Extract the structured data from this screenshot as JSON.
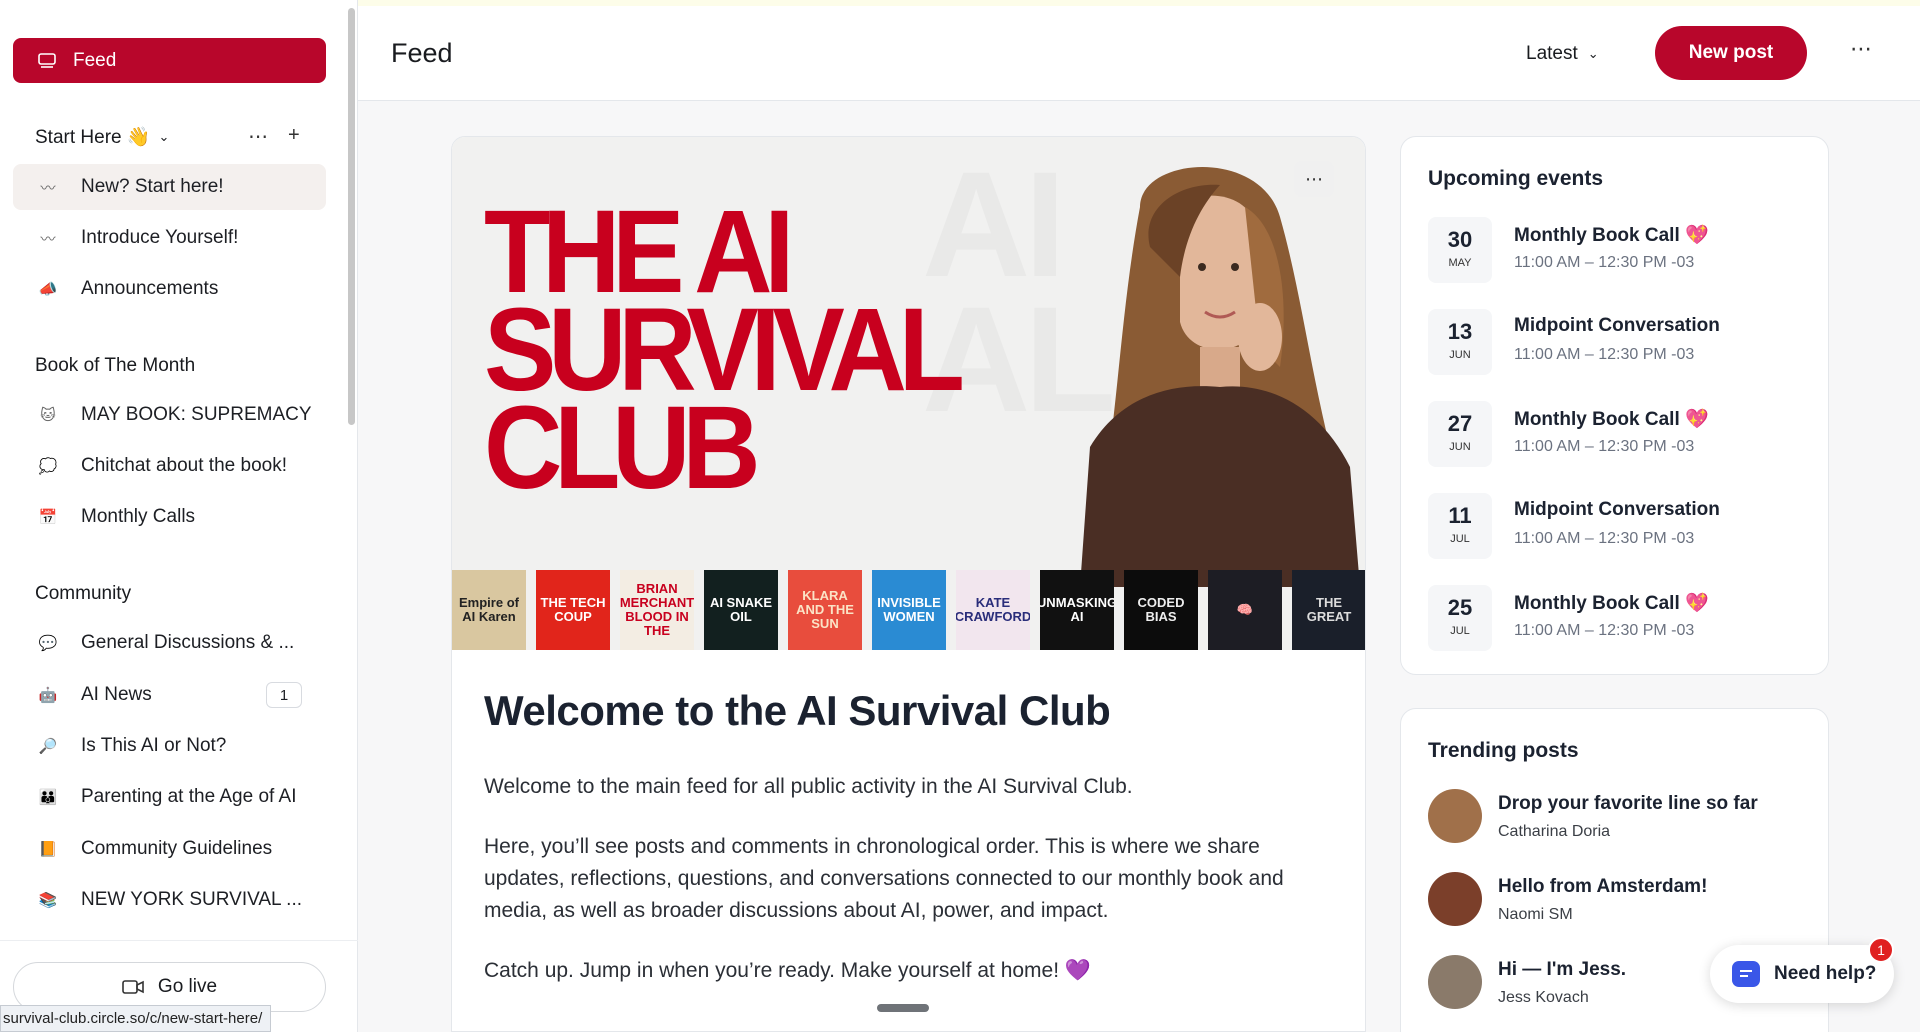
{
  "sidebar": {
    "feed_label": "Feed",
    "groups": {
      "start_here": "Start Here 👋",
      "book_of_month": "Book of The Month",
      "community": "Community"
    },
    "items": [
      {
        "icon": "〰",
        "label": "New? Start here!"
      },
      {
        "icon": "〰",
        "label": "Introduce Yourself!"
      },
      {
        "icon": "📣",
        "label": "Announcements"
      },
      {
        "icon": "🐱",
        "label": "MAY BOOK: SUPREMACY"
      },
      {
        "icon": "💭",
        "label": "Chitchat about the book!"
      },
      {
        "icon": "📅",
        "label": "Monthly Calls"
      },
      {
        "icon": "💬",
        "label": "General Discussions & ..."
      },
      {
        "icon": "🤖",
        "label": "AI News",
        "badge": "1"
      },
      {
        "icon": "🔎",
        "label": "Is This AI or Not?"
      },
      {
        "icon": "👪",
        "label": "Parenting at the Age of AI"
      },
      {
        "icon": "📙",
        "label": "Community Guidelines"
      },
      {
        "icon": "📚",
        "label": "NEW YORK SURVIVAL ..."
      }
    ],
    "go_live": "Go live",
    "status_url": "survival-club.circle.so/c/new-start-here/"
  },
  "header": {
    "title": "Feed",
    "sort": "Latest",
    "new_post": "New post"
  },
  "post": {
    "banner_title": [
      "THE AI",
      "SURVIVAL",
      "CLUB"
    ],
    "books": [
      {
        "title": "Empire of AI Karen",
        "bg": "#d9c7a0",
        "fg": "#222"
      },
      {
        "title": "THE TECH COUP",
        "bg": "#e1251b",
        "fg": "#fff"
      },
      {
        "title": "BRIAN MERCHANT BLOOD IN THE",
        "bg": "#f3ede3",
        "fg": "#c8001e"
      },
      {
        "title": "AI SNAKE OIL",
        "bg": "#12201f",
        "fg": "#fff"
      },
      {
        "title": "KLARA AND THE SUN",
        "bg": "#e84d3d",
        "fg": "#fbe3c6"
      },
      {
        "title": "INVISIBLE WOMEN",
        "bg": "#2a8bd3",
        "fg": "#fff"
      },
      {
        "title": "KATE CRAWFORD",
        "bg": "#f2e6ee",
        "fg": "#2a2d7a"
      },
      {
        "title": "UNMASKING AI",
        "bg": "#111",
        "fg": "#fff"
      },
      {
        "title": "CODED BIAS",
        "bg": "#0c0c0c",
        "fg": "#eee"
      },
      {
        "title": "🧠",
        "bg": "#1d1d24",
        "fg": "#e44d8a"
      },
      {
        "title": "THE GREAT",
        "bg": "#1a1f2a",
        "fg": "#ddd"
      }
    ],
    "title": "Welcome to the AI Survival Club",
    "paragraphs": [
      "Welcome to the main feed for all public activity in the AI Survival Club.",
      "Here, you’ll see posts and comments in chronological order. This is where we share updates, reflections, questions, and conversations connected to our monthly book and media, as well as broader discussions about AI, power, and impact.",
      "Catch up. Jump in when you’re ready. Make yourself at home! 💜"
    ]
  },
  "events": {
    "title": "Upcoming events",
    "items": [
      {
        "day": "30",
        "month": "MAY",
        "name": "Monthly Book Call 💖",
        "time": "11:00 AM – 12:30 PM -03"
      },
      {
        "day": "13",
        "month": "JUN",
        "name": "Midpoint Conversation",
        "time": "11:00 AM – 12:30 PM -03"
      },
      {
        "day": "27",
        "month": "JUN",
        "name": "Monthly Book Call 💖",
        "time": "11:00 AM – 12:30 PM -03"
      },
      {
        "day": "11",
        "month": "JUL",
        "name": "Midpoint Conversation",
        "time": "11:00 AM – 12:30 PM -03"
      },
      {
        "day": "25",
        "month": "JUL",
        "name": "Monthly Book Call 💖",
        "time": "11:00 AM – 12:30 PM -03"
      }
    ]
  },
  "trending": {
    "title": "Trending posts",
    "items": [
      {
        "title": "Drop your favorite line so far",
        "author": "Catharina Doria",
        "avatar_color": "#a0704a"
      },
      {
        "title": "Hello from Amsterdam!",
        "author": "Naomi SM",
        "avatar_color": "#7b3f2a"
      },
      {
        "title": "Hi — I'm Jess.",
        "author": "Jess Kovach",
        "avatar_color": "#8a7a6a"
      }
    ]
  },
  "help": {
    "label": "Need help?",
    "badge": "1"
  },
  "colors": {
    "brand": "#b8062b",
    "accent": "#c8001e"
  }
}
